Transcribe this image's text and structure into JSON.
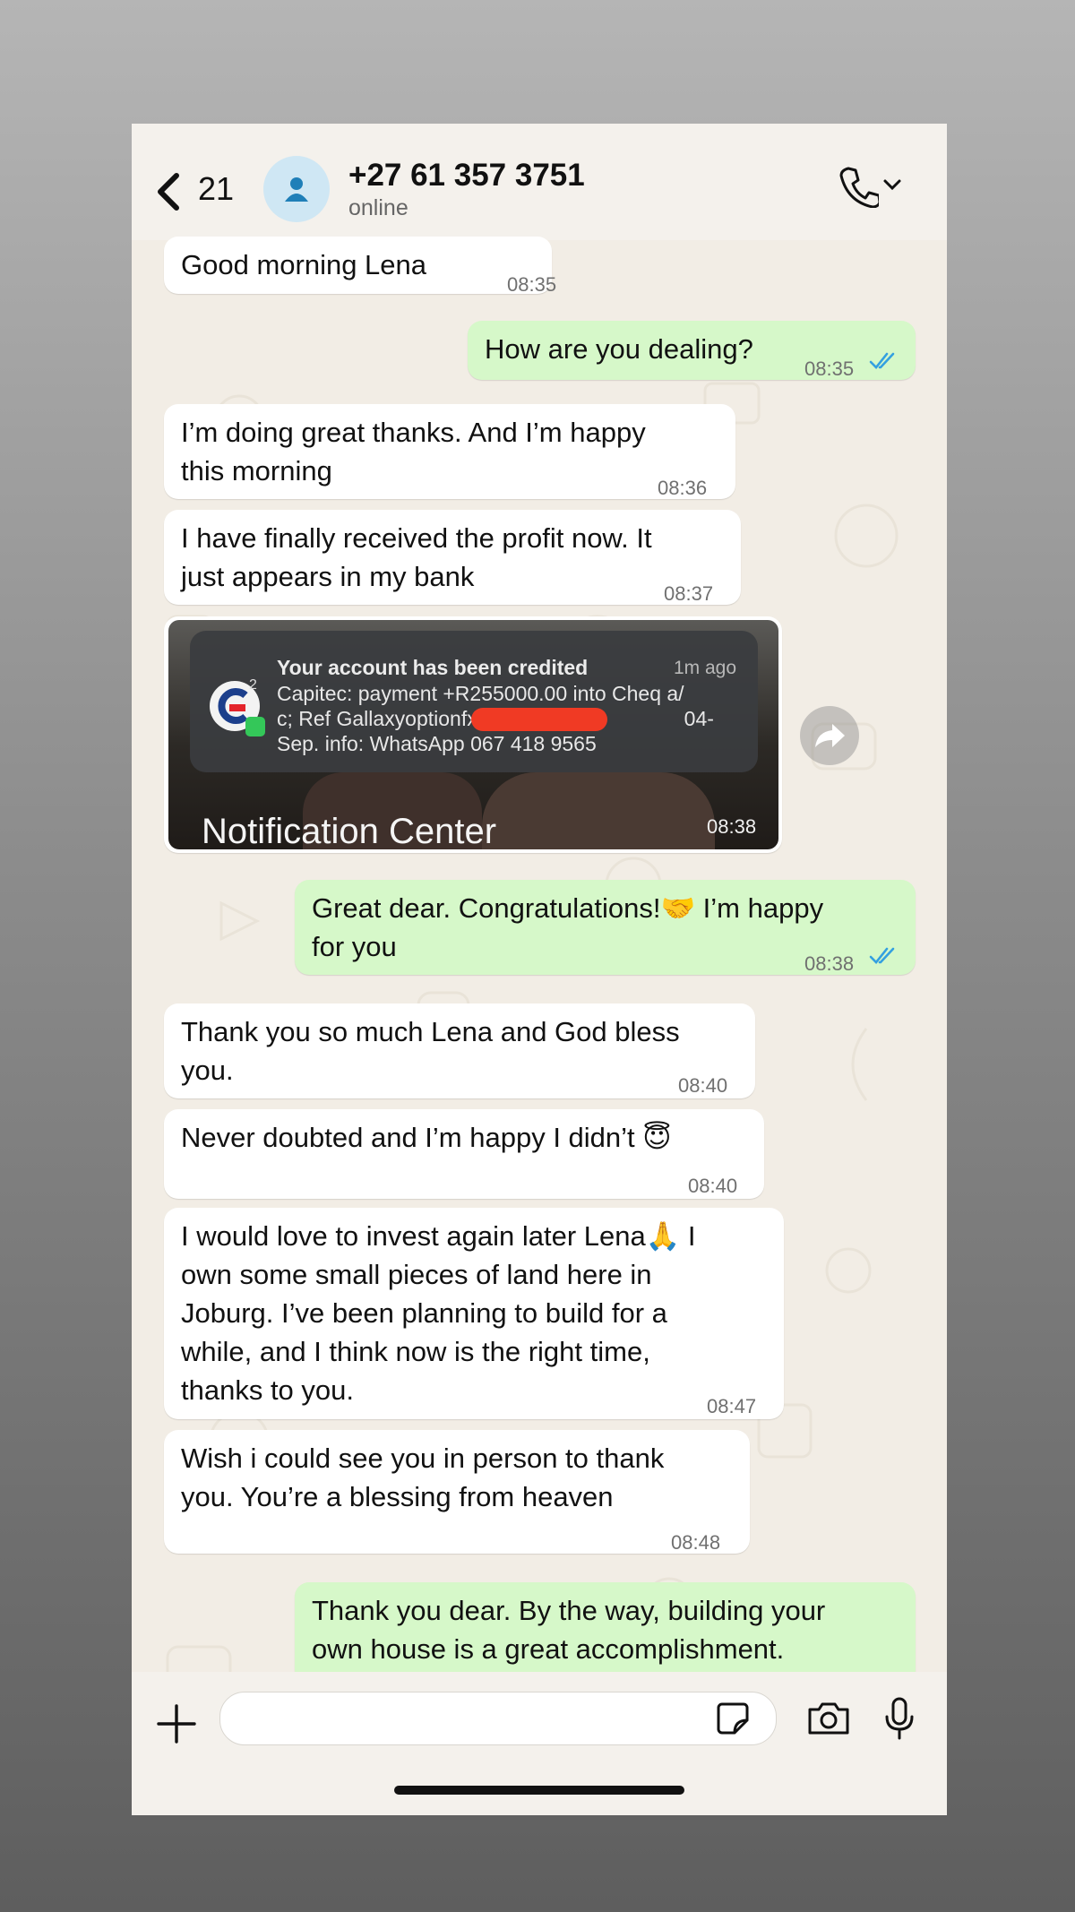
{
  "header": {
    "back_count": "21",
    "contact_name": "+27 61 357 3751",
    "status": "online"
  },
  "messages": [
    {
      "dir": "in",
      "lines": [
        "Good morning Lena"
      ],
      "time": "08:35"
    },
    {
      "dir": "out",
      "lines": [
        "How are you dealing?"
      ],
      "time": "08:35",
      "read": true
    },
    {
      "dir": "in",
      "lines": [
        "I’m doing great thanks. And I’m happy",
        "this morning"
      ],
      "time": "08:36"
    },
    {
      "dir": "in",
      "lines": [
        "I have finally received the profit now. It",
        "just appears in my bank"
      ],
      "time": "08:37"
    },
    {
      "dir": "out",
      "lines": [
        "Great dear. Congratulations!🤝 I’m happy",
        "for you"
      ],
      "time": "08:38",
      "read": true
    },
    {
      "dir": "in",
      "lines": [
        "Thank you so much Lena and God bless",
        "you."
      ],
      "time": "08:40"
    },
    {
      "dir": "in",
      "lines": [
        "Never doubted and I’m happy I didn’t 😇"
      ],
      "time": "08:40"
    },
    {
      "dir": "in",
      "lines": [
        "I would love to invest again later Lena🙏 I",
        "own some small pieces of land here in",
        "Joburg. I’ve been planning to build for a",
        "while, and I think now is the right time,",
        "thanks to you."
      ],
      "time": "08:47"
    },
    {
      "dir": "in",
      "lines": [
        "Wish i could see you in person to thank",
        "you. You’re a blessing from heaven"
      ],
      "time": "08:48"
    },
    {
      "dir": "out",
      "lines": [
        "Thank you dear. By the way, building your",
        "own house is a great accomplishment."
      ],
      "time": ""
    }
  ],
  "image_message": {
    "time": "08:38",
    "caption": "Notification Center",
    "notification": {
      "title": "Your account has been credited",
      "time": "1m ago",
      "badge_count": "2",
      "body_lines": [
        "Capitec: payment +R255000.00 into Cheq a/",
        "c; Ref Gallaxyoptionfx; Avail",
        "Sep. info: WhatsApp 067 418 9565"
      ],
      "body_after_redaction": "04-"
    }
  },
  "input": {
    "placeholder": ""
  },
  "colors": {
    "incoming": "#ffffff",
    "outgoing": "#d6f8c9",
    "read_ticks": "#34a0e0",
    "background": "#f2ede5"
  },
  "icons": [
    "back-chevron-icon",
    "person-icon",
    "phone-icon",
    "chevron-down-icon",
    "forward-icon",
    "plus-icon",
    "sticker-icon",
    "camera-icon",
    "microphone-icon"
  ]
}
